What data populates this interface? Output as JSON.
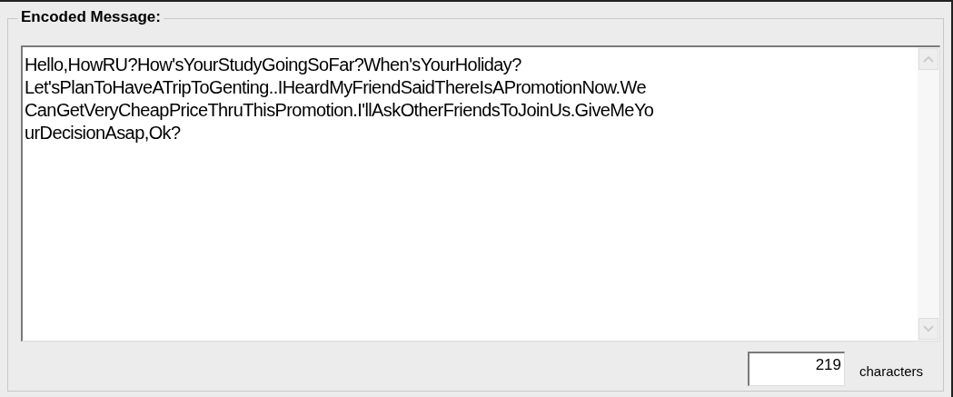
{
  "group": {
    "title": "Encoded Message:"
  },
  "message": {
    "lines": [
      "Hello,HowRU?How'sYourStudyGoingSoFar?When'sYourHoliday?",
      "Let'sPlanToHaveATripToGenting..IHeardMyFriendSaidThereIsAPromotionNow.We",
      "CanGetVeryCheapPriceThruThisPromotion.I'llAskOtherFriendsToJoinUs.GiveMeYo",
      "urDecisionAsap,Ok?"
    ]
  },
  "count": {
    "value": "219",
    "label": "characters"
  }
}
